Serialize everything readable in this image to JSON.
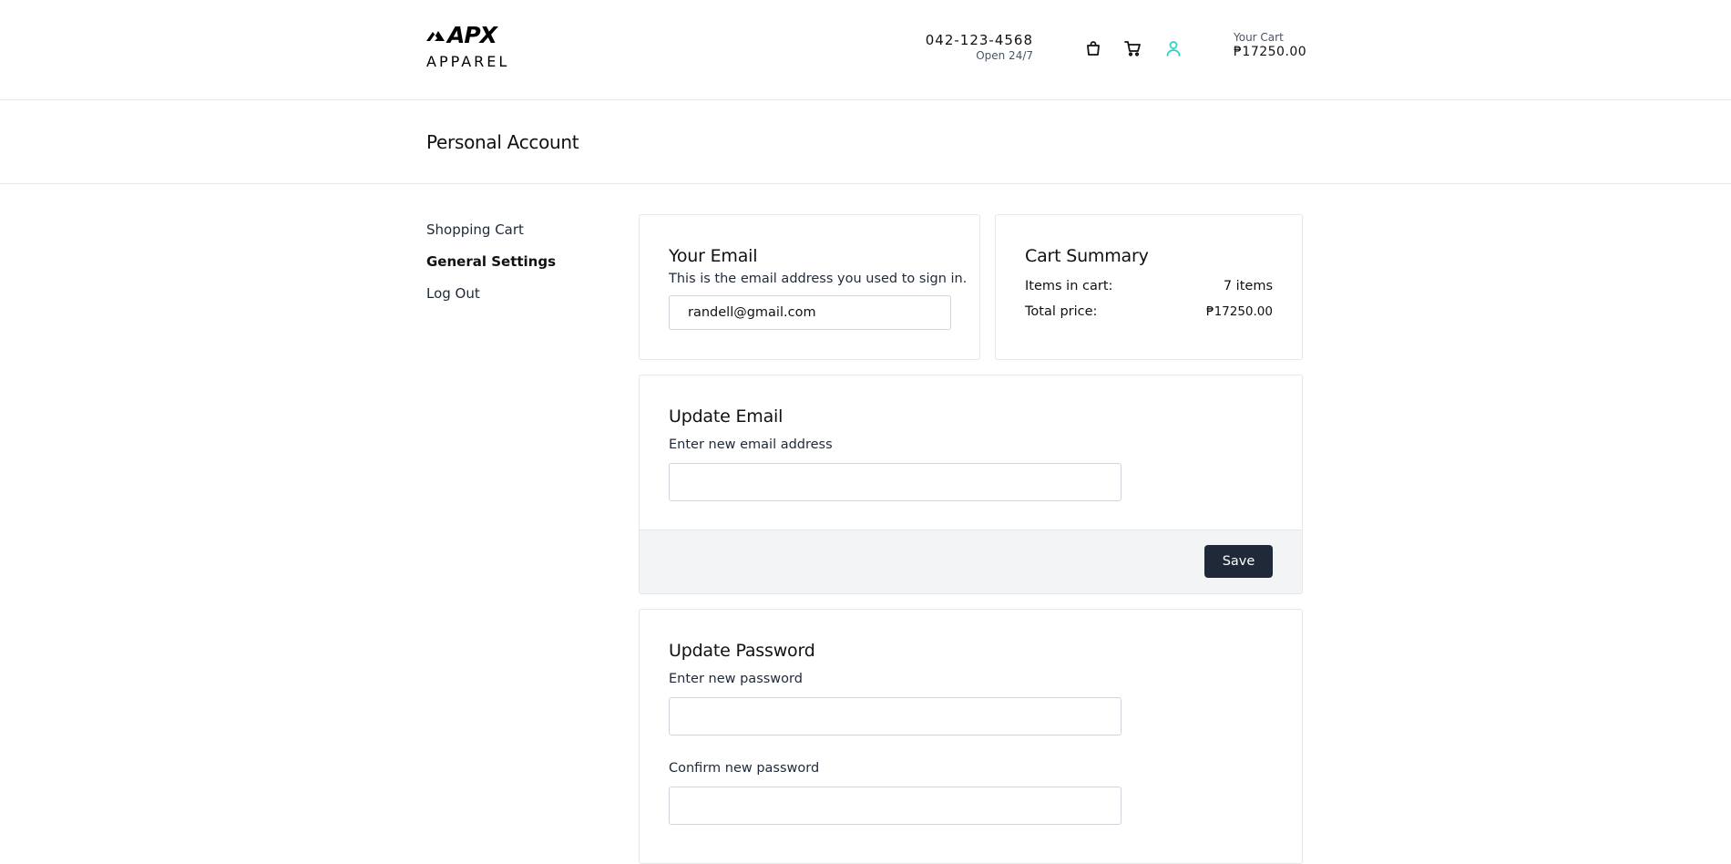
{
  "header": {
    "brand_name": "APX",
    "brand_sub": "APPAREL",
    "phone": "042-123-4568",
    "hours": "Open 24/7",
    "icons": [
      "shopping-bag-icon",
      "shopping-cart-icon",
      "user-icon"
    ],
    "accent_color": "#2dd4bf",
    "cart_label": "Your Cart",
    "cart_total": "₱17250.00"
  },
  "page": {
    "title": "Personal Account"
  },
  "sidebar": {
    "items": [
      {
        "label": "Shopping Cart",
        "active": false
      },
      {
        "label": "General Settings",
        "active": true
      },
      {
        "label": "Log Out",
        "active": false
      }
    ]
  },
  "email_card": {
    "title": "Your Email",
    "description": "This is the email address you used to sign in.",
    "value": "randell@gmail.com"
  },
  "summary_card": {
    "title": "Cart Summary",
    "items_label": "Items in cart:",
    "items_value": "7 items",
    "total_label": "Total price:",
    "total_value": "₱17250.00"
  },
  "update_email": {
    "title": "Update Email",
    "label": "Enter new email address",
    "value": "",
    "save_label": "Save"
  },
  "update_password": {
    "title": "Update Password",
    "new_label": "Enter new password",
    "confirm_label": "Confirm new password"
  },
  "colors": {
    "primary_button": "#1f2937",
    "footer_bg": "#f3f4f6",
    "border": "#e5e7eb"
  }
}
